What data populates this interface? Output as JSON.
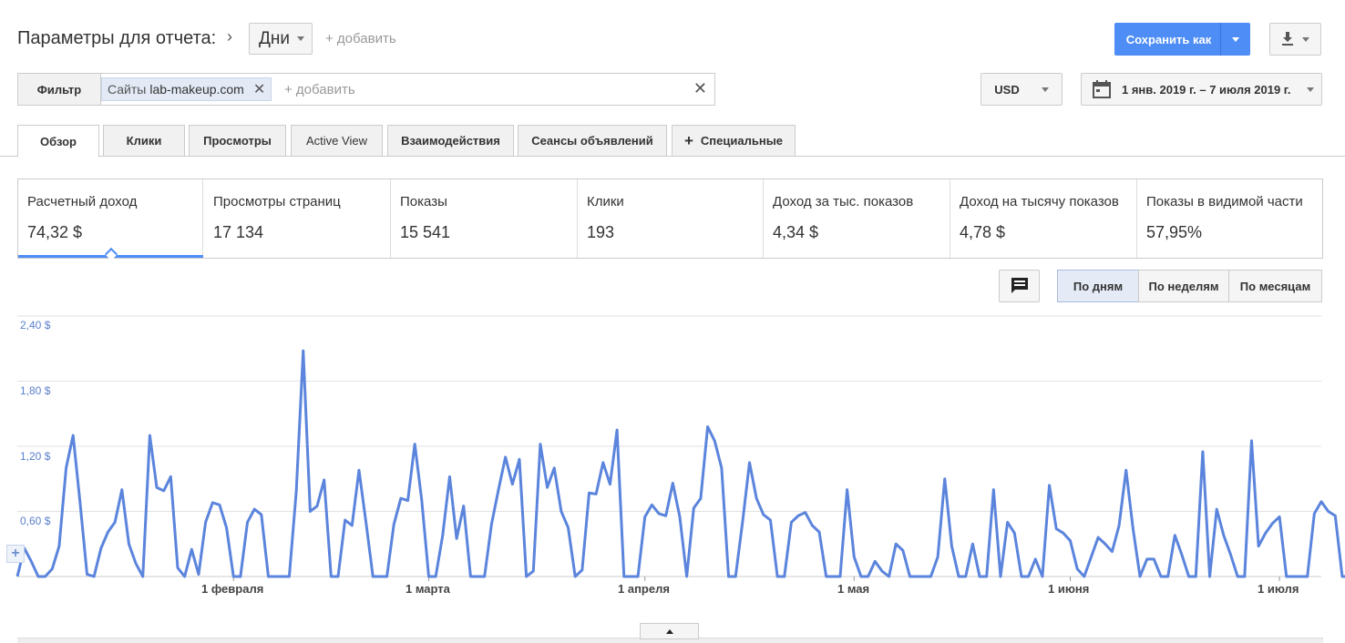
{
  "header": {
    "title": "Параметры для отчета:",
    "dimension": "Дни",
    "add_label": "+ добавить",
    "save_label": "Сохранить как"
  },
  "filter": {
    "filter_label": "Фильтр",
    "chip_key": "Сайты",
    "chip_value": "lab-makeup.com",
    "add_placeholder": "+ добавить"
  },
  "currency": "USD",
  "date_range": "1 янв. 2019 г. – 7 июля 2019 г.",
  "tabs": [
    {
      "label": "Обзор"
    },
    {
      "label": "Клики"
    },
    {
      "label": "Просмотры"
    },
    {
      "label": "Active View"
    },
    {
      "label": "Взаимодействия"
    },
    {
      "label": "Сеансы объявлений"
    },
    {
      "label": "Специальные"
    }
  ],
  "metrics": [
    {
      "label": "Расчетный доход",
      "value": "74,32 $"
    },
    {
      "label": "Просмотры страниц",
      "value": "17 134"
    },
    {
      "label": "Показы",
      "value": "15 541"
    },
    {
      "label": "Клики",
      "value": "193"
    },
    {
      "label": "Доход за тыс. показов",
      "value": "4,34 $"
    },
    {
      "label": "Доход на тысячу показов",
      "value": "4,78 $"
    },
    {
      "label": "Показы в видимой части",
      "value": "57,95%"
    }
  ],
  "granularity": {
    "day": "По дням",
    "week": "По неделям",
    "month": "По месяцам"
  },
  "colors": {
    "accent": "#4d8df5",
    "line": "#5b84dc",
    "save_button": "#4d8df5"
  },
  "chart_data": {
    "type": "line",
    "y_ticks": [
      "2,40 $",
      "1,80 $",
      "1,20 $",
      "0,60 $"
    ],
    "ylim": [
      0,
      2.4
    ],
    "x_ticks": [
      "1 февраля",
      "1 марта",
      "1 апреля",
      "1 мая",
      "1 июня",
      "1 июля"
    ],
    "x_tick_days": [
      31,
      59,
      90,
      120,
      151,
      181
    ],
    "x_range_days": [
      0,
      187
    ],
    "series": [
      {
        "values": [
          0.0,
          0.26,
          0.14,
          0.0,
          0.0,
          0.07,
          0.28,
          1.0,
          1.3,
          0.68,
          0.02,
          0.0,
          0.26,
          0.41,
          0.5,
          0.8,
          0.3,
          0.12,
          0.0,
          1.3,
          0.82,
          0.79,
          0.92,
          0.08,
          0.0,
          0.25,
          0.02,
          0.5,
          0.68,
          0.66,
          0.45,
          0.0,
          0.0,
          0.5,
          0.62,
          0.57,
          0.0,
          0.0,
          0.0,
          0.0,
          0.78,
          2.08,
          0.6,
          0.65,
          0.89,
          0.0,
          0.0,
          0.52,
          0.47,
          0.98,
          0.5,
          0.0,
          0.0,
          0.0,
          0.48,
          0.72,
          0.7,
          1.22,
          0.7,
          0.0,
          0.0,
          0.38,
          0.92,
          0.35,
          0.65,
          0.0,
          0.0,
          0.0,
          0.48,
          0.8,
          1.1,
          0.85,
          1.08,
          0.0,
          0.05,
          1.22,
          0.82,
          1.0,
          0.6,
          0.45,
          0.0,
          0.06,
          0.77,
          0.76,
          1.05,
          0.85,
          1.35,
          0.0,
          0.0,
          0.0,
          0.55,
          0.66,
          0.58,
          0.56,
          0.86,
          0.55,
          0.0,
          0.63,
          0.72,
          1.38,
          1.25,
          1.0,
          0.0,
          0.0,
          0.5,
          1.05,
          0.72,
          0.57,
          0.52,
          0.0,
          0.0,
          0.5,
          0.56,
          0.59,
          0.47,
          0.41,
          0.0,
          0.0,
          0.0,
          0.8,
          0.18,
          0.0,
          0.0,
          0.14,
          0.05,
          0.0,
          0.3,
          0.24,
          0.0,
          0.0,
          0.0,
          0.0,
          0.18,
          0.9,
          0.28,
          0.0,
          0.0,
          0.3,
          0.0,
          0.0,
          0.8,
          0.0,
          0.5,
          0.4,
          0.0,
          0.0,
          0.16,
          0.0,
          0.84,
          0.44,
          0.4,
          0.33,
          0.07,
          0.0,
          0.18,
          0.36,
          0.3,
          0.23,
          0.47,
          0.98,
          0.44,
          0.0,
          0.16,
          0.16,
          0.0,
          0.0,
          0.38,
          0.2,
          0.0,
          0.0,
          1.15,
          0.0,
          0.62,
          0.38,
          0.2,
          0.0,
          0.0,
          1.25,
          0.28,
          0.4,
          0.49,
          0.55,
          0.0,
          0.0,
          0.0,
          0.0,
          0.58,
          0.69,
          0.6,
          0.56,
          0.0,
          0.0
        ]
      }
    ]
  }
}
